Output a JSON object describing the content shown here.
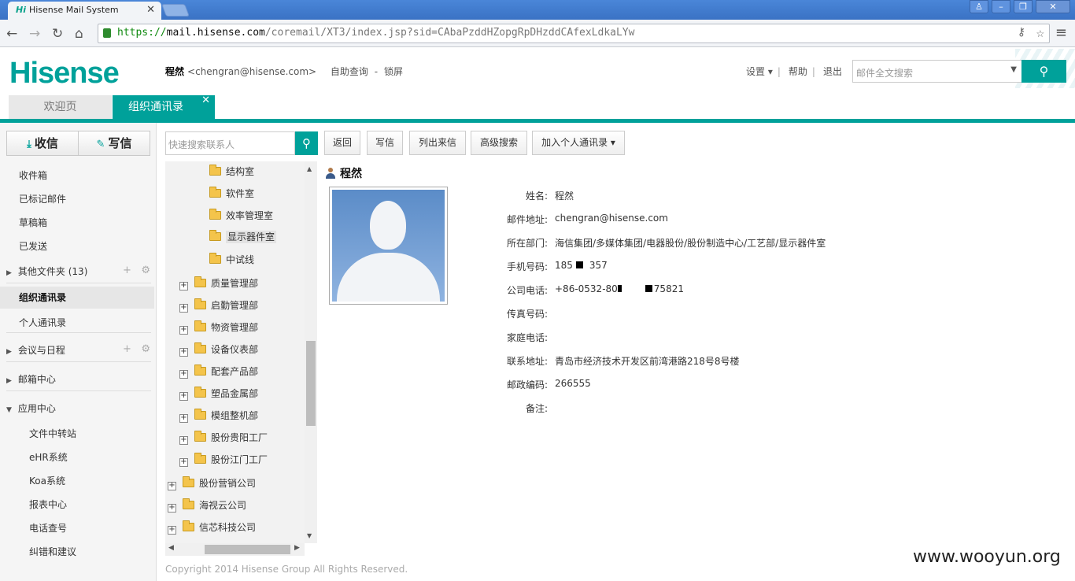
{
  "browser": {
    "tab_title": "Hisense Mail System",
    "tab_icon": "Hi",
    "url_scheme": "https://",
    "url_host": "mail.hisense.com",
    "url_path": "/coremail/XT3/index.jsp?sid=CAbaPzddHZopgRpDHzddCAfexLdkaLYw"
  },
  "header": {
    "logo": "Hisense",
    "user_name": "程然",
    "user_email": "<chengran@hisense.com>",
    "self_service": "自助查询",
    "dash": "-",
    "lock": "锁屏",
    "settings": "设置 ▾",
    "help": "帮助",
    "logout": "退出",
    "sep": "|",
    "search_placeholder": "邮件全文搜索"
  },
  "app_tabs": {
    "welcome": "欢迎页",
    "directory": "组织通讯录"
  },
  "sidebar": {
    "receive": "收信",
    "write": "写信",
    "inbox": "收件箱",
    "flagged": "已标记邮件",
    "drafts": "草稿箱",
    "sent": "已发送",
    "other_folders": "其他文件夹 (13)",
    "org_directory": "组织通讯录",
    "personal_directory": "个人通讯录",
    "meetings": "会议与日程",
    "mailbox_center": "邮箱中心",
    "app_center": "应用中心",
    "apps": [
      "文件中转站",
      "eHR系统",
      "Koa系统",
      "报表中心",
      "电话查号",
      "纠错和建议"
    ]
  },
  "toolbar": {
    "quick_search_placeholder": "快速搜索联系人",
    "back": "返回",
    "write": "写信",
    "list_mail": "列出来信",
    "adv_search": "高级搜索",
    "add_personal": "加入个人通讯录 ▾"
  },
  "tree": {
    "sub_items": [
      "结构室",
      "软件室",
      "效率管理室",
      "显示器件室",
      "中试线"
    ],
    "dept_items": [
      "质量管理部",
      "启勤管理部",
      "物资管理部",
      "设备仪表部",
      "配套产品部",
      "塑品金属部",
      "模组整机部",
      "股份贵阳工厂",
      "股份江门工厂"
    ],
    "company_items": [
      "股份营销公司",
      "海视云公司",
      "信芯科技公司"
    ]
  },
  "contact": {
    "name": "程然",
    "fields": [
      {
        "label": "姓名:",
        "value": "程然"
      },
      {
        "label": "邮件地址:",
        "value": "chengran@hisense.com"
      },
      {
        "label": "所在部门:",
        "value": "海信集团/多媒体集团/电器股份/股份制造中心/工艺部/显示器件室"
      },
      {
        "label": "手机号码:",
        "value_a": "185",
        "value_b": "357"
      },
      {
        "label": "公司电话:",
        "value_a": "+86-0532-80",
        "value_b": "75821"
      },
      {
        "label": "传真号码:",
        "value": ""
      },
      {
        "label": "家庭电话:",
        "value": ""
      },
      {
        "label": "联系地址:",
        "value": "青岛市经济技术开发区前湾港路218号8号楼"
      },
      {
        "label": "邮政编码:",
        "value": "266555"
      },
      {
        "label": "备注:",
        "value": ""
      }
    ]
  },
  "footer": "Copyright 2014 Hisense Group All Rights Reserved.",
  "watermark": "www.wooyun.org"
}
